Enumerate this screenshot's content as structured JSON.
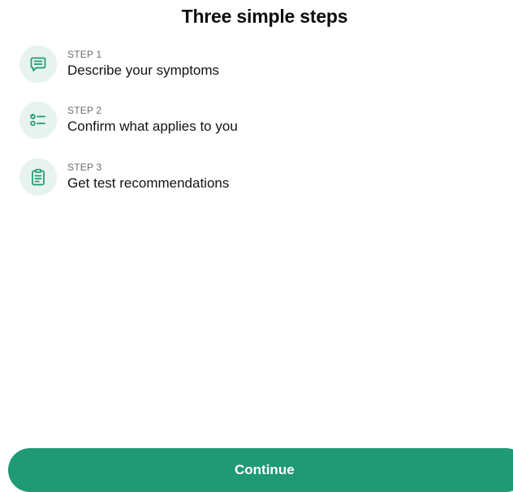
{
  "title": "Three simple steps",
  "steps": [
    {
      "kicker": "STEP 1",
      "text": "Describe your symptoms",
      "icon": "chat-icon"
    },
    {
      "kicker": "STEP 2",
      "text": "Confirm what applies to you",
      "icon": "checklist-icon"
    },
    {
      "kicker": "STEP 3",
      "text": "Get test recommendations",
      "icon": "clipboard-icon"
    }
  ],
  "continue_label": "Continue",
  "colors": {
    "accent": "#1f9a74",
    "icon_bg": "#e7f3ee",
    "icon_stroke": "#1f9a74"
  }
}
